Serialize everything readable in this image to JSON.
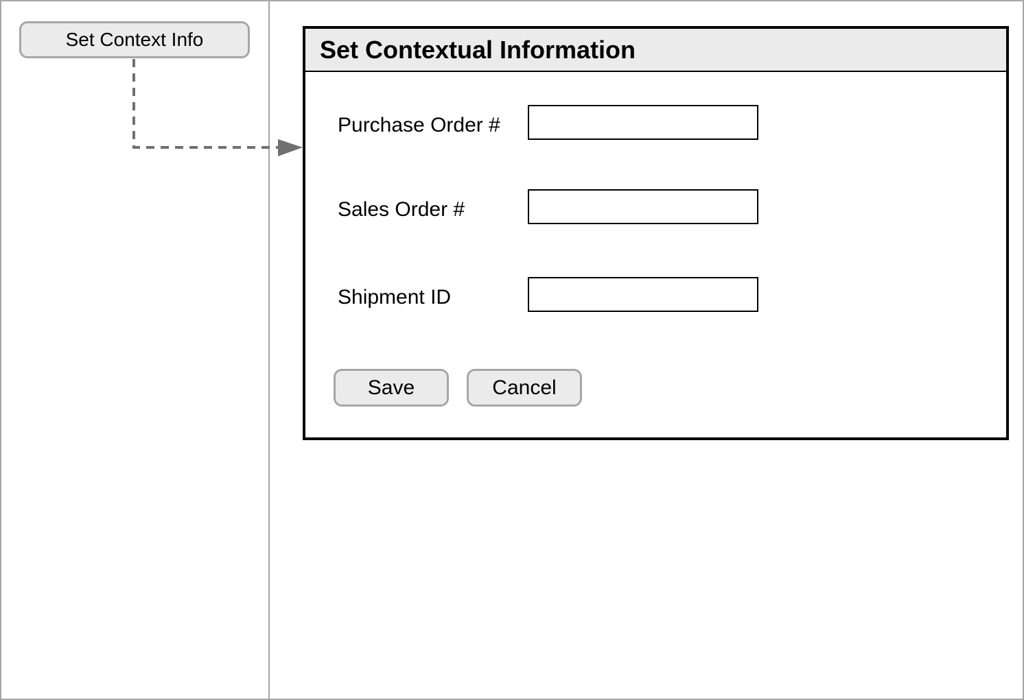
{
  "sidebar": {
    "context_button_label": "Set Context Info"
  },
  "dialog": {
    "title": "Set Contextual Information",
    "fields": [
      {
        "label": "Purchase Order #",
        "value": "",
        "placeholder": ""
      },
      {
        "label": "Sales Order #",
        "value": "",
        "placeholder": ""
      },
      {
        "label": "Shipment ID",
        "value": "",
        "placeholder": ""
      }
    ],
    "save_label": "Save",
    "cancel_label": "Cancel"
  },
  "colors": {
    "border_gray": "#a6a6a6",
    "button_fill": "#ebebeb",
    "header_fill": "#ebebeb",
    "connector": "#707070"
  }
}
